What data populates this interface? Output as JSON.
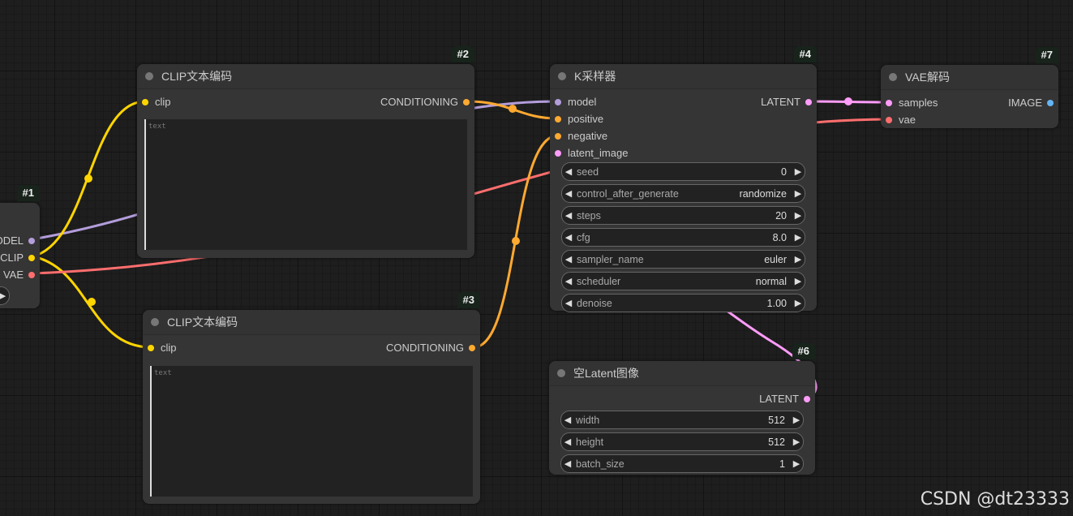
{
  "colors": {
    "model": "#b39ddb",
    "clip": "#ffd500",
    "vae": "#ff6e6e",
    "conditioning": "#ffa931",
    "latent": "#ff9cf9",
    "image": "#64b5f6"
  },
  "nodes": {
    "loader": {
      "badge": "#1",
      "outputs": {
        "model": "ODEL",
        "clip": "CLIP",
        "vae": "VAE"
      },
      "widget_arrow": "▶"
    },
    "clip_pos": {
      "badge": "#2",
      "title": "CLIP文本编码",
      "input": "clip",
      "output": "CONDITIONING",
      "text_placeholder": "text"
    },
    "clip_neg": {
      "badge": "#3",
      "title": "CLIP文本编码",
      "input": "clip",
      "output": "CONDITIONING",
      "text_placeholder": "text"
    },
    "ksampler": {
      "badge": "#4",
      "title": "K采样器",
      "inputs": [
        "model",
        "positive",
        "negative",
        "latent_image"
      ],
      "output": "LATENT",
      "widgets": [
        {
          "name": "seed",
          "value": "0"
        },
        {
          "name": "control_after_generate",
          "value": "randomize"
        },
        {
          "name": "steps",
          "value": "20"
        },
        {
          "name": "cfg",
          "value": "8.0"
        },
        {
          "name": "sampler_name",
          "value": "euler"
        },
        {
          "name": "scheduler",
          "value": "normal"
        },
        {
          "name": "denoise",
          "value": "1.00"
        }
      ]
    },
    "latent": {
      "badge": "#6",
      "title": "空Latent图像",
      "output": "LATENT",
      "widgets": [
        {
          "name": "width",
          "value": "512"
        },
        {
          "name": "height",
          "value": "512"
        },
        {
          "name": "batch_size",
          "value": "1"
        }
      ]
    },
    "vae_decode": {
      "badge": "#7",
      "title": "VAE解码",
      "inputs": [
        "samples",
        "vae"
      ],
      "output": "IMAGE"
    }
  },
  "watermark": "CSDN @dt23333"
}
